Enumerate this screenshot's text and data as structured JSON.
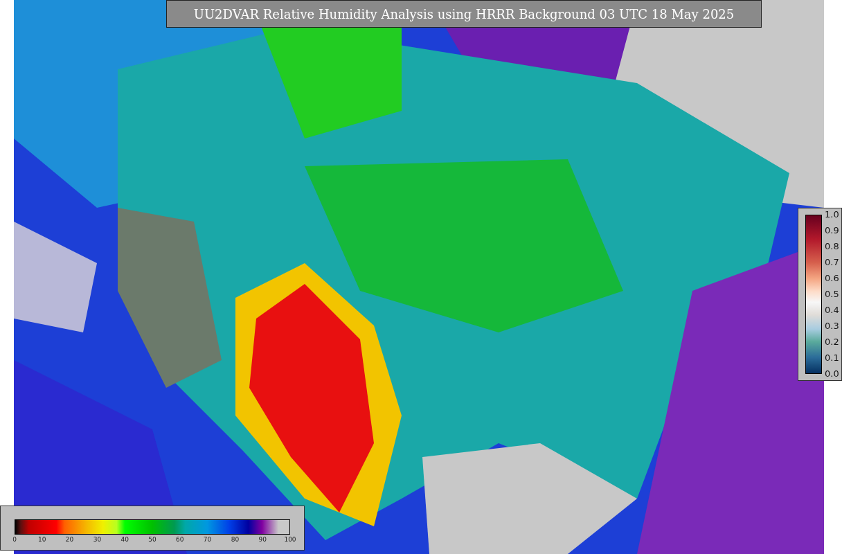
{
  "title": "UU2DVAR Relative Humidity Analysis using HRRR Background 03 UTC 18 May 2025",
  "humidity_colorbar": {
    "ticks": [
      "0",
      "10",
      "20",
      "30",
      "40",
      "50",
      "60",
      "70",
      "80",
      "90",
      "100"
    ]
  },
  "observation_colorbar": {
    "ticks": [
      "1.0",
      "0.9",
      "0.8",
      "0.7",
      "0.6",
      "0.5",
      "0.4",
      "0.3",
      "0.2",
      "0.1",
      "0.0"
    ]
  }
}
